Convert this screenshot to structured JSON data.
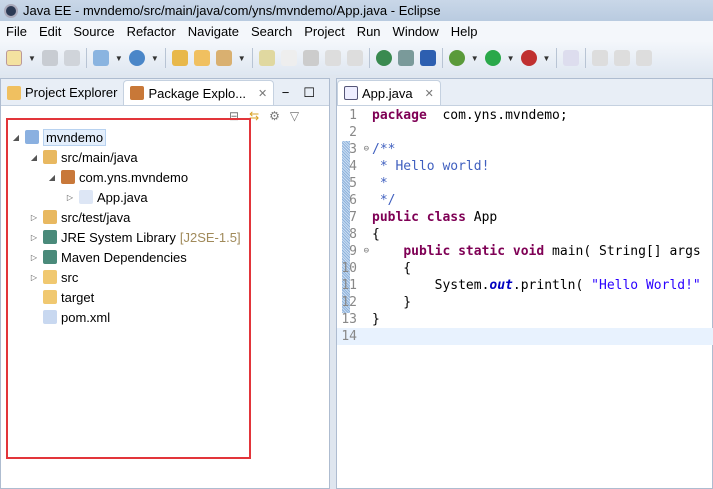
{
  "title": "Java EE - mvndemo/src/main/java/com/yns/mvndemo/App.java - Eclipse",
  "menu": [
    "File",
    "Edit",
    "Source",
    "Refactor",
    "Navigate",
    "Search",
    "Project",
    "Run",
    "Window",
    "Help"
  ],
  "left_tabs": [
    {
      "label": "Project Explorer"
    },
    {
      "label": "Package Explo..."
    }
  ],
  "editor_tab": "App.java",
  "tree": [
    {
      "label": "mvndemo",
      "depth": 0,
      "twisty": "open",
      "icon": "maven-project-icon"
    },
    {
      "label": "src/main/java",
      "depth": 1,
      "twisty": "open",
      "icon": "source-folder-icon"
    },
    {
      "label": "com.yns.mvndemo",
      "depth": 2,
      "twisty": "open",
      "icon": "package-icon"
    },
    {
      "label": "App.java",
      "depth": 3,
      "twisty": "closed",
      "icon": "java-file-icon"
    },
    {
      "label": "src/test/java",
      "depth": 1,
      "twisty": "closed",
      "icon": "source-folder-icon"
    },
    {
      "label": "JRE System Library",
      "decoration": "[J2SE-1.5]",
      "depth": 1,
      "twisty": "closed",
      "icon": "library-icon"
    },
    {
      "label": "Maven Dependencies",
      "depth": 1,
      "twisty": "closed",
      "icon": "library-icon"
    },
    {
      "label": "src",
      "depth": 1,
      "twisty": "closed",
      "icon": "folder-icon"
    },
    {
      "label": "target",
      "depth": 1,
      "twisty": "none",
      "icon": "folder-icon"
    },
    {
      "label": "pom.xml",
      "depth": 1,
      "twisty": "none",
      "icon": "maven-file-icon"
    }
  ],
  "code": [
    {
      "n": "1",
      "t": [
        [
          "kw",
          "package"
        ],
        [
          "",
          "  com.yns.mvndemo;"
        ]
      ]
    },
    {
      "n": "2",
      "t": []
    },
    {
      "n": "3",
      "fold": true,
      "t": [
        [
          "cm",
          "/**"
        ]
      ]
    },
    {
      "n": "4",
      "t": [
        [
          "cm",
          " * Hello world!"
        ]
      ]
    },
    {
      "n": "5",
      "t": [
        [
          "cm",
          " *"
        ]
      ]
    },
    {
      "n": "6",
      "t": [
        [
          "cm",
          " */"
        ]
      ]
    },
    {
      "n": "7",
      "t": [
        [
          "kw",
          "public"
        ],
        [
          "",
          " "
        ],
        [
          "kw",
          "class"
        ],
        [
          "",
          " App"
        ]
      ]
    },
    {
      "n": "8",
      "t": [
        [
          "",
          "{"
        ]
      ]
    },
    {
      "n": "9",
      "fold": true,
      "t": [
        [
          "",
          "    "
        ],
        [
          "kw",
          "public"
        ],
        [
          "",
          " "
        ],
        [
          "kw",
          "static"
        ],
        [
          "",
          " "
        ],
        [
          "kw",
          "void"
        ],
        [
          "",
          " main( String[] args"
        ]
      ]
    },
    {
      "n": "10",
      "t": [
        [
          "",
          "    {"
        ]
      ]
    },
    {
      "n": "11",
      "t": [
        [
          "",
          "        System."
        ],
        [
          "it",
          "out"
        ],
        [
          "",
          ".println( "
        ],
        [
          "st",
          "\"Hello World!\""
        ]
      ]
    },
    {
      "n": "12",
      "t": [
        [
          "",
          "    }"
        ]
      ]
    },
    {
      "n": "13",
      "t": [
        [
          "",
          "}"
        ]
      ]
    },
    {
      "n": "14",
      "t": [],
      "current": true
    }
  ]
}
